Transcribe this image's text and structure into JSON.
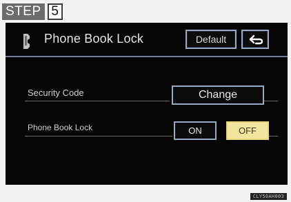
{
  "step": {
    "label": "STEP",
    "number": "5"
  },
  "header": {
    "icon": "phone-icon",
    "title": "Phone Book Lock",
    "default_label": "Default",
    "back_icon": "back-arrow-icon"
  },
  "rows": [
    {
      "label": "Security Code",
      "button_label": "Change"
    },
    {
      "label": "Phone Book Lock",
      "on_label": "ON",
      "off_label": "OFF",
      "selected": "OFF"
    }
  ],
  "footer": {
    "code": "CLY50AH003"
  },
  "colors": {
    "screen_bg": "#050505",
    "button_border": "#9aa9c4",
    "selected_bg": "#f3e7a0",
    "step_bg": "#6b6b6b"
  }
}
